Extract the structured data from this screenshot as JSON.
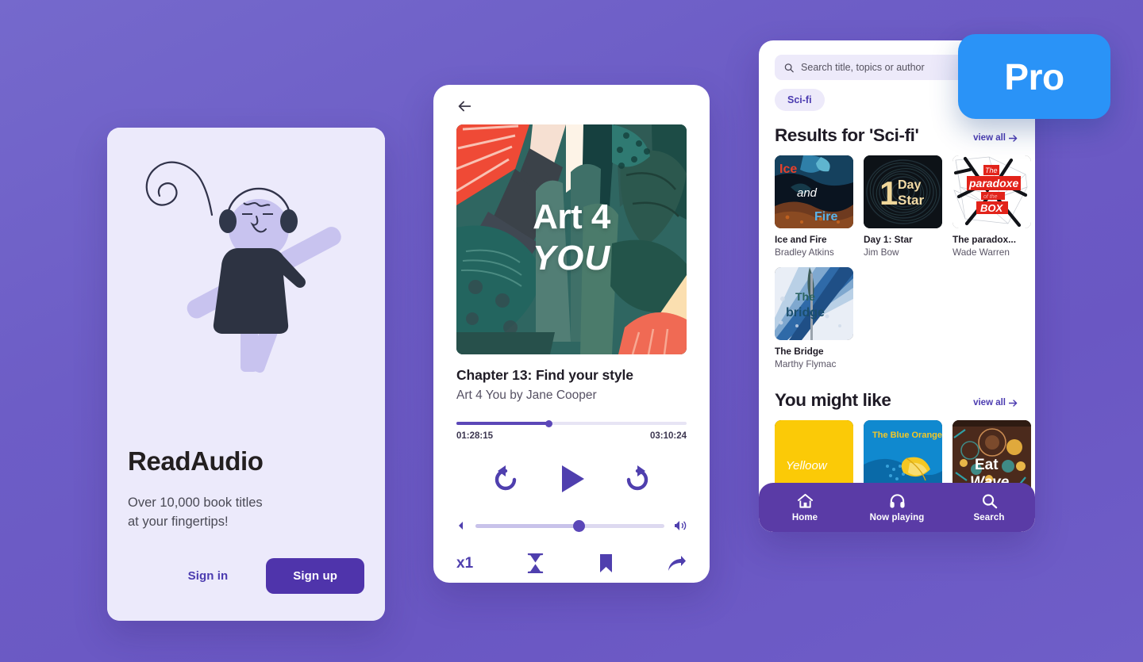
{
  "theme": {
    "bg_purple": "#6d5dc6",
    "accent_purple": "#4f34ab",
    "band_purple": "#6b63f5",
    "nav_purple": "#5a3ba6",
    "pro_blue": "#2a93f7",
    "card_lilac": "#eceafb"
  },
  "onboarding": {
    "illustration_icon": "person-with-headphones-illustration",
    "title": "ReadAudio",
    "subtitle": "Over 10,000 book titles\nat your fingertips!",
    "signin_label": "Sign in",
    "signup_label": "Sign up"
  },
  "player": {
    "back_icon": "arrow-left-icon",
    "cover_title_line1": "Art 4",
    "cover_title_line2": "YOU",
    "track_title": "Chapter 13: Find your style",
    "track_subtitle": "Art 4 You by Jane Cooper",
    "elapsed": "01:28:15",
    "duration": "03:10:24",
    "progress_percent": 40,
    "volume_percent": 55,
    "controls": {
      "rewind_icon": "rewind-15-icon",
      "play_icon": "play-icon",
      "forward_icon": "forward-30-icon",
      "volume_down_icon": "volume-down-icon",
      "volume_up_icon": "volume-up-icon"
    },
    "tools": {
      "speed_label": "x1",
      "sleep_timer_icon": "hourglass-icon",
      "bookmark_icon": "bookmark-icon",
      "share_icon": "share-icon"
    }
  },
  "browse": {
    "search": {
      "icon": "search-icon",
      "placeholder": "Search title, topics or author",
      "value": ""
    },
    "chips": [
      {
        "label": "Sci-fi",
        "active": true
      }
    ],
    "sections": [
      {
        "title": "Results for 'Sci-fi'",
        "view_all_label": "view all",
        "view_all_icon": "arrow-right-icon",
        "items": [
          {
            "title": "Ice and Fire",
            "author": "Bradley Atkins",
            "cover": "ice-and-fire-cover",
            "cover_text": [
              "Ice",
              "and",
              "Fire"
            ]
          },
          {
            "title": "Day 1: Star",
            "author": "Jim Bow",
            "cover": "day-1-star-cover",
            "cover_text": [
              "1",
              "Day",
              "Star"
            ]
          },
          {
            "title": "The paradox...",
            "author": "Wade Warren",
            "cover": "paradoxe-of-the-box-cover",
            "cover_text": [
              "The",
              "paradoxe",
              "of the",
              "BOX"
            ]
          },
          {
            "title": "The Bridge",
            "author": "Marthy Flymac",
            "cover": "the-bridge-cover",
            "cover_text": [
              "The",
              "bridge"
            ]
          }
        ]
      },
      {
        "title": "You might like",
        "view_all_label": "view all",
        "view_all_icon": "arrow-right-icon",
        "items": [
          {
            "title": "",
            "author": "",
            "cover": "yelloow-cover",
            "cover_text": [
              "Yelloow"
            ]
          },
          {
            "title": "",
            "author": "",
            "cover": "blue-orange-cover",
            "cover_text": [
              "The Blue Orange"
            ]
          },
          {
            "title": "",
            "author": "",
            "cover": "eat-wave-cover",
            "cover_text": [
              "Eat",
              "Wave"
            ]
          }
        ]
      }
    ],
    "nav": [
      {
        "label": "Home",
        "icon": "home-icon",
        "active": true
      },
      {
        "label": "Now playing",
        "icon": "headphones-icon",
        "active": false
      },
      {
        "label": "Search",
        "icon": "search-icon",
        "active": false
      }
    ]
  },
  "pro_badge": {
    "label": "Pro"
  }
}
